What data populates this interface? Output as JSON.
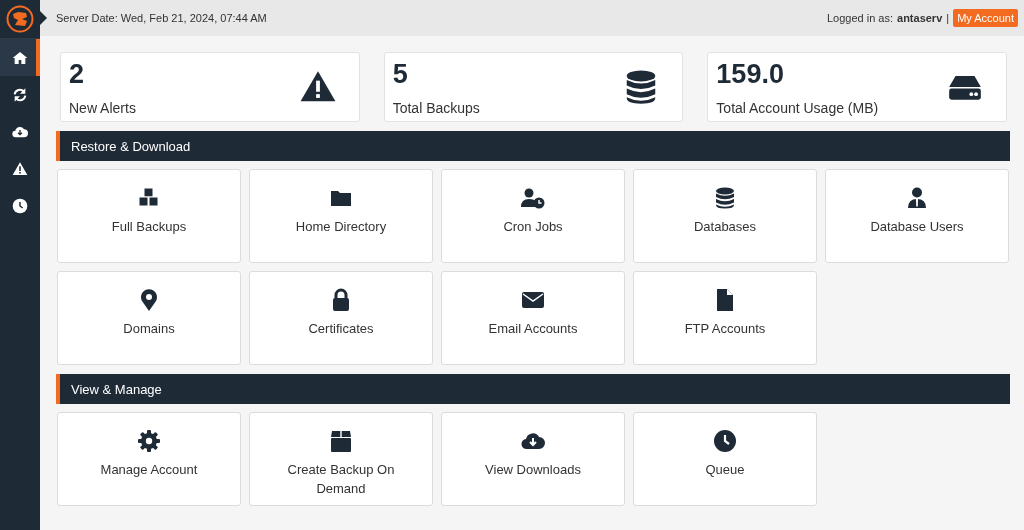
{
  "header": {
    "server_date": "Server Date: Wed, Feb 21, 2024, 07:44 AM",
    "logged_in_label": "Logged in as:",
    "username": "antaserv",
    "separator": "|",
    "account_button": "My Account"
  },
  "sidebar": {
    "items": [
      {
        "selected": true
      },
      {
        "selected": false
      },
      {
        "selected": false
      },
      {
        "selected": false
      },
      {
        "selected": false
      }
    ]
  },
  "stats": [
    {
      "value": "2",
      "label": "New Alerts"
    },
    {
      "value": "5",
      "label": "Total Backups"
    },
    {
      "value": "159.0",
      "label": "Total Account Usage (MB)"
    }
  ],
  "sections": [
    {
      "title": "Restore & Download",
      "tiles": [
        "Full Backups",
        "Home Directory",
        "Cron Jobs",
        "Databases",
        "Database Users",
        "Domains",
        "Certificates",
        "Email Accounts",
        "FTP Accounts"
      ]
    },
    {
      "title": "View & Manage",
      "tiles": [
        "Manage Account",
        "Create Backup On Demand",
        "View Downloads",
        "Queue"
      ]
    }
  ]
}
